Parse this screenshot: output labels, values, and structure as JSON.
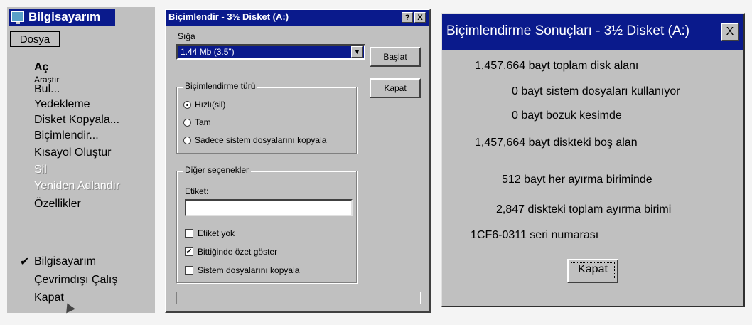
{
  "menu_panel": {
    "title": "Bilgisayarım",
    "menu_header": "Dosya",
    "items": [
      {
        "label": "Aç",
        "enabled": true
      },
      {
        "label": "Araştır",
        "enabled": true
      },
      {
        "label": "Bul...",
        "enabled": true
      },
      {
        "label": "Yedekleme",
        "enabled": true
      },
      {
        "label": "Disket Kopyala...",
        "enabled": true
      },
      {
        "label": "Biçimlendir...",
        "enabled": true
      },
      {
        "label": "Kısayol Oluştur",
        "enabled": true
      },
      {
        "label": "Sil",
        "enabled": false
      },
      {
        "label": "Yeniden Adlandır",
        "enabled": false
      },
      {
        "label": "Özellikler",
        "enabled": true
      },
      {
        "label": "Bilgisayarım",
        "enabled": true,
        "checked": true
      },
      {
        "label": "Çevrimdışı Çalış",
        "enabled": true
      },
      {
        "label": "Kapat",
        "enabled": true
      }
    ],
    "checkmark": "✔"
  },
  "format_dialog": {
    "title": "Biçimlendir - 3½ Disket (A:)",
    "help_btn": "?",
    "close_btn": "X",
    "capacity_label": "Sığa",
    "capacity_value": "1.44 Mb (3.5\")",
    "start_button": "Başlat",
    "close_button": "Kapat",
    "format_type_group": "Biçimlendirme türü",
    "format_options": [
      {
        "label": "Hızlı(sil)",
        "selected": true
      },
      {
        "label": "Tam",
        "selected": false
      },
      {
        "label": "Sadece sistem dosyalarını kopyala",
        "selected": false
      }
    ],
    "other_options_group": "Diğer seçenekler",
    "label_field_label": "Etiket:",
    "label_field_value": "",
    "other_options": [
      {
        "label": "Etiket yok",
        "checked": false
      },
      {
        "label": "Bittiğinde özet göster",
        "checked": true
      },
      {
        "label": "Sistem dosyalarını kopyala",
        "checked": false
      }
    ]
  },
  "results_dialog": {
    "title": "Biçimlendirme Sonuçları - 3½ Disket (A:)",
    "close_btn": "X",
    "lines": [
      "1,457,664 bayt toplam disk alanı",
      "0 bayt sistem dosyaları kullanıyor",
      "0 bayt bozuk kesimde",
      "1,457,664 bayt diskteki boş alan",
      "512 bayt her ayırma biriminde",
      "2,847 diskteki toplam ayırma birimi",
      "1CF6-0311 seri numarası"
    ],
    "ok_button": "Kapat"
  }
}
